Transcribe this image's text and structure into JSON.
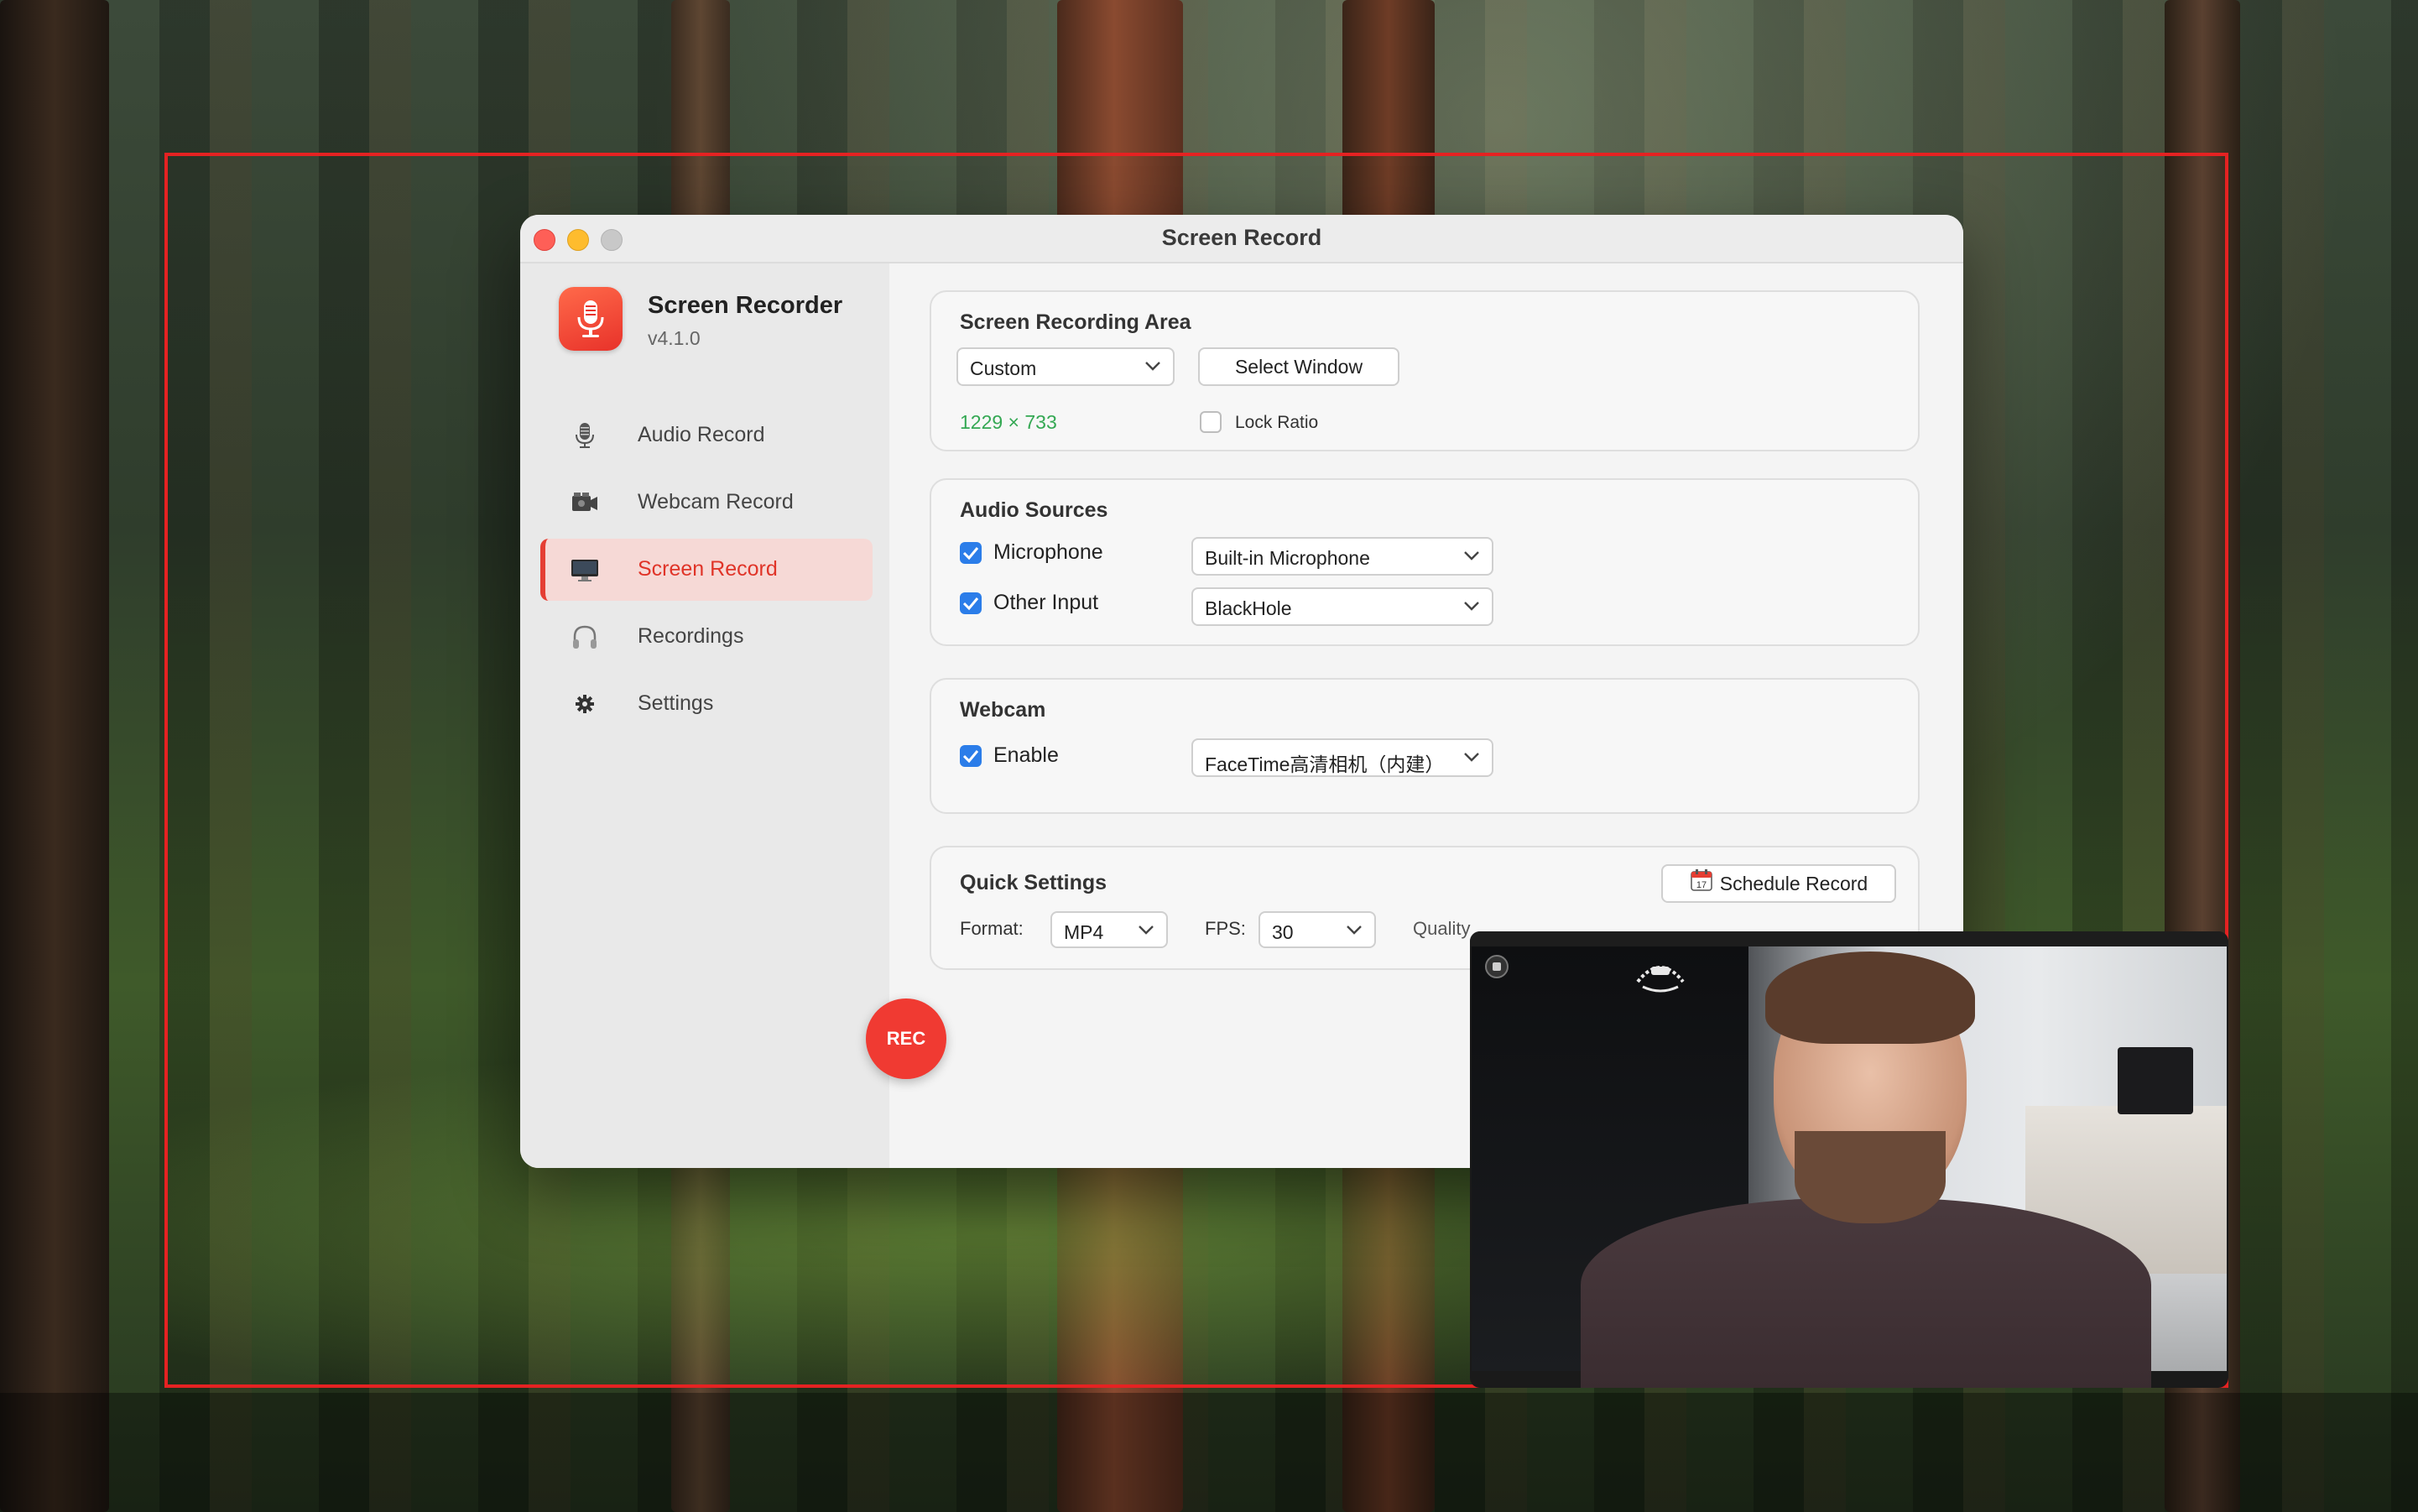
{
  "window": {
    "title": "Screen Record"
  },
  "app": {
    "name": "Screen Recorder",
    "version": "v4.1.0"
  },
  "sidebar": {
    "items": [
      {
        "label": "Audio Record",
        "icon": "microphone-icon"
      },
      {
        "label": "Webcam Record",
        "icon": "webcam-icon"
      },
      {
        "label": "Screen Record",
        "icon": "monitor-icon",
        "active": true
      },
      {
        "label": "Recordings",
        "icon": "headphones-icon"
      },
      {
        "label": "Settings",
        "icon": "gear-icon"
      }
    ]
  },
  "recording_area": {
    "title": "Screen Recording Area",
    "mode": "Custom",
    "select_window_label": "Select Window",
    "dimensions": "1229 × 733",
    "lock_ratio_label": "Lock Ratio",
    "lock_ratio_checked": false
  },
  "audio_sources": {
    "title": "Audio Sources",
    "microphone_label": "Microphone",
    "microphone_checked": true,
    "microphone_device": "Built-in Microphone",
    "other_input_label": "Other Input",
    "other_input_checked": true,
    "other_input_device": "BlackHole"
  },
  "webcam": {
    "title": "Webcam",
    "enable_label": "Enable",
    "enable_checked": true,
    "device": "FaceTime高清相机（内建）"
  },
  "quick_settings": {
    "title": "Quick Settings",
    "format_label": "Format:",
    "format_value": "MP4",
    "fps_label": "FPS:",
    "fps_value": "30",
    "quality_label": "Quality",
    "schedule_label": "Schedule Record",
    "schedule_icon": "calendar-icon"
  },
  "rec_button_label": "REC",
  "colors": {
    "accent": "#e53e33",
    "dimension_text": "#34a853",
    "checkbox": "#2b7de9",
    "frame": "#e52222"
  }
}
